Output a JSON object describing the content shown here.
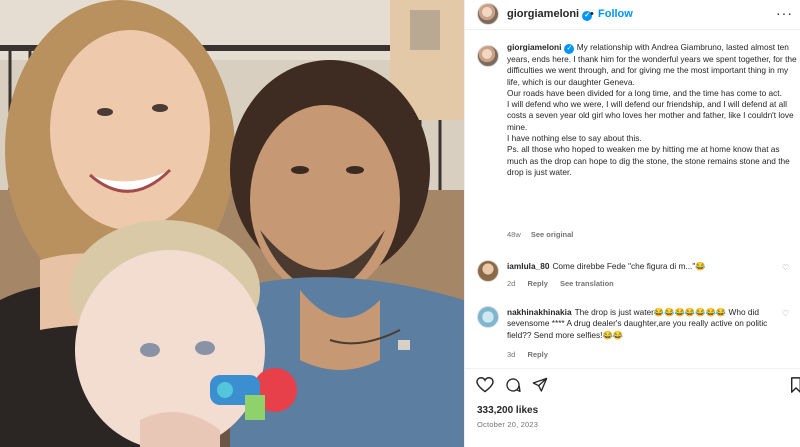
{
  "post": {
    "username": "giorgiameloni",
    "verified_mark": "✓",
    "dot": "•",
    "follow_label": "Follow",
    "more_label": "···"
  },
  "caption": {
    "username": "giorgiameloni",
    "paragraphs": [
      "My relationship with Andrea Giambruno, lasted almost ten years, ends here. I thank him for the wonderful years we spent together, for the difficulties we went through, and for giving me the most important thing in my life, which is our daughter Geneva.",
      "Our roads have been divided for a long time, and the time has come to act.",
      "I will defend who we were, I will defend our friendship, and I will defend at all costs a seven year old girl who loves her mother and father, like I couldn't love mine.",
      "I have nothing else to say about this.",
      "Ps. all those who hoped to weaken me by hitting me at home know that as much as the drop can hope to dig the stone, the stone remains stone and the drop is just water."
    ],
    "time": "48w",
    "see_original": "See original"
  },
  "comments": [
    {
      "username": "iamlula_80",
      "text": "Come direbbe Fede \"che figura di m...\"😂",
      "time": "2d",
      "reply": "Reply",
      "translation": "See translation"
    },
    {
      "username": "nakhinakhinakia",
      "text": "The drop is just water😂😂😂😂😂😂😂 Who did sevensome **** A drug dealer's daughter,are you really active on politic field?? Send more selfies!😂😂",
      "time": "3d",
      "reply": "Reply"
    }
  ],
  "footer": {
    "likes": "333,200 likes",
    "date": "October 20, 2023"
  },
  "icons": [
    "heart-icon",
    "comment-icon",
    "share-icon",
    "bookmark-icon",
    "verified-badge-icon",
    "more-options-icon"
  ],
  "colors": {
    "accent": "#0095f6",
    "muted": "#737373",
    "text": "#262626",
    "border": "#efefef"
  }
}
